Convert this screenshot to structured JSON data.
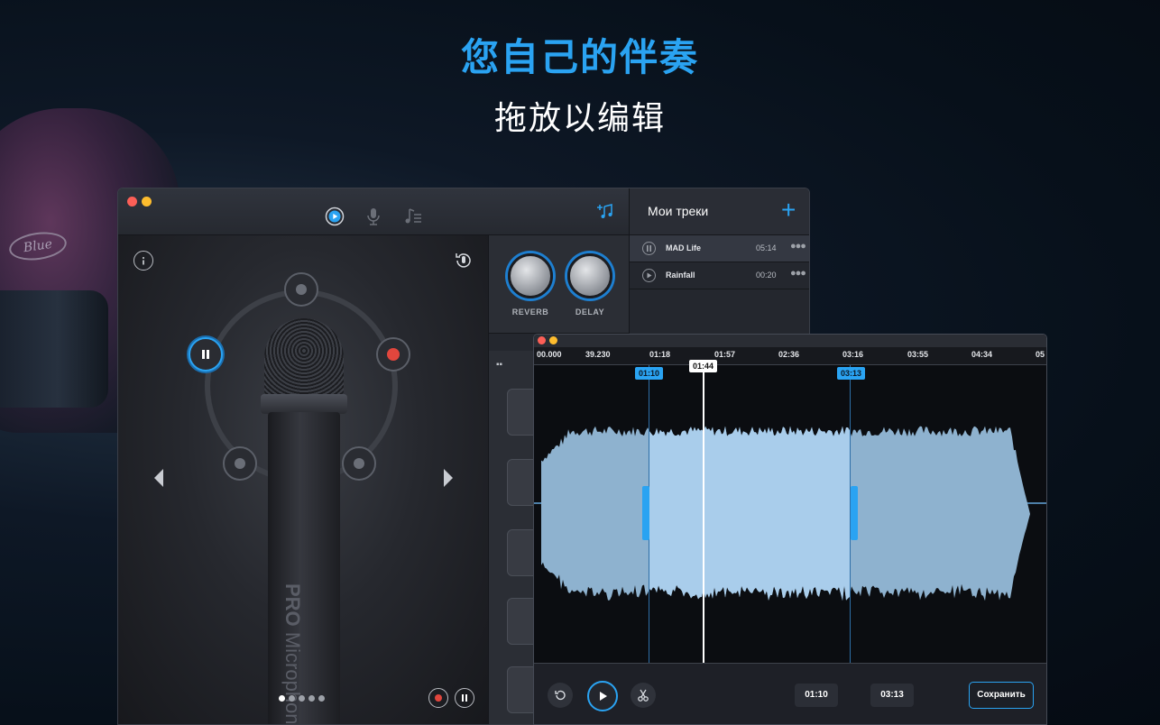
{
  "headline": "您自己的伴奏",
  "subline": "拖放以编辑",
  "background": {
    "logo_text": "Blue"
  },
  "main_window": {
    "toolbar_icons": [
      "play-icon",
      "microphone-icon",
      "playlist-icon",
      "add-music-icon"
    ],
    "stage": {
      "mic_brand": "PRO",
      "mic_name": "Microphone",
      "page_count": 5,
      "active_page": 1
    },
    "effects": {
      "reverb_label": "REVERB",
      "delay_label": "DELAY"
    },
    "tracks": {
      "title": "Мои треки",
      "add_label": "+",
      "items": [
        {
          "name": "MAD Life",
          "duration": "05:14",
          "playing": true
        },
        {
          "name": "Rainfall",
          "duration": "00:20",
          "playing": false
        }
      ]
    }
  },
  "editor": {
    "ruler_ticks": [
      "00.000",
      "39.230",
      "01:18",
      "01:57",
      "02:36",
      "03:16",
      "03:55",
      "04:34",
      "05"
    ],
    "selection_start": "01:10",
    "selection_end": "03:13",
    "playhead": "01:44",
    "start_time_field": "01:10",
    "end_time_field": "03:13",
    "save_label": "Сохранить"
  },
  "colors": {
    "accent": "#2aa3f2",
    "record": "#e1463d",
    "wave": "#8eb2cf",
    "wave_selected": "#a9cdeb"
  }
}
